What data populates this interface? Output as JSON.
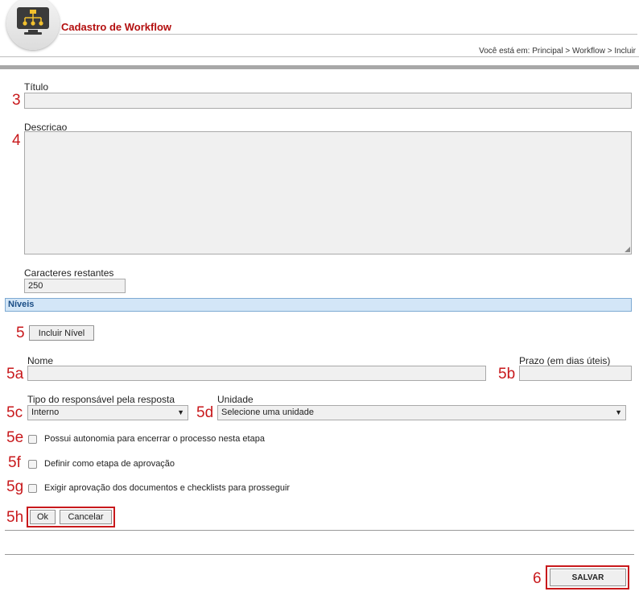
{
  "header": {
    "logo_icon": "workflow-monitor-icon",
    "title": "Cadastro de Workflow",
    "breadcrumb": "Você está em: Principal > Workflow > Incluir"
  },
  "form": {
    "titulo": {
      "label": "Título",
      "value": ""
    },
    "descricao": {
      "label": "Descricao",
      "value": ""
    },
    "caracteres": {
      "label": "Caracteres restantes",
      "value": "250"
    }
  },
  "niveis": {
    "section_title": "Níveis",
    "incluir_button": "Incluir Nível",
    "nome_label": "Nome",
    "nome_value": "",
    "prazo_label": "Prazo (em dias úteis)",
    "prazo_value": "",
    "tipo_label": "Tipo do responsável pela resposta",
    "tipo_value": "Interno",
    "unidade_label": "Unidade",
    "unidade_value": "Selecione uma unidade",
    "check_autonomia": "Possui autonomia para encerrar o processo nesta etapa",
    "check_aprovacao": "Definir como etapa de aprovação",
    "check_exigir": "Exigir aprovação dos documentos e checklists para prosseguir",
    "ok_button": "Ok",
    "cancelar_button": "Cancelar"
  },
  "footer": {
    "salvar_button": "SALVAR"
  },
  "annotations": {
    "n3": "3",
    "n4": "4",
    "n5": "5",
    "n5a": "5a",
    "n5b": "5b",
    "n5c": "5c",
    "n5d": "5d",
    "n5e": "5e",
    "n5f": "5f",
    "n5g": "5g",
    "n5h": "5h",
    "n6": "6"
  },
  "colors": {
    "title_red": "#b30f0f",
    "annotation_red": "#c8191c",
    "section_blue": "#d3e6f7"
  }
}
